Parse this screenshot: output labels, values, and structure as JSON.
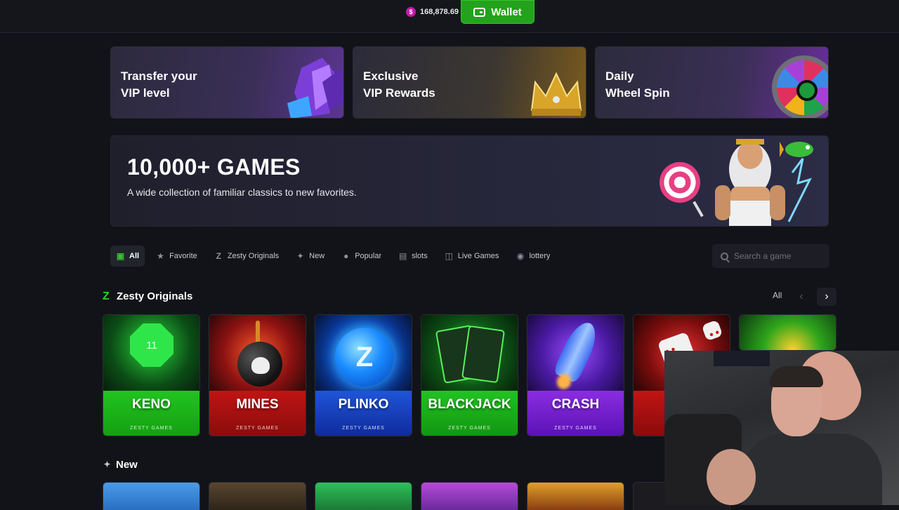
{
  "header": {
    "balance": "168,878.69",
    "balance_symbol": "$",
    "wallet_label": "Wallet"
  },
  "promos": [
    {
      "line1": "Transfer your",
      "line2": "VIP level"
    },
    {
      "line1": "Exclusive",
      "line2": "VIP Rewards"
    },
    {
      "line1": "Daily",
      "line2": "Wheel Spin"
    }
  ],
  "hero": {
    "title": "10,000+ GAMES",
    "subtitle": "A wide collection of familiar classics to new favorites."
  },
  "categories": [
    {
      "label": "All",
      "icon": "slot-machine-icon",
      "active": true
    },
    {
      "label": "Favorite",
      "icon": "star-icon"
    },
    {
      "label": "Zesty Originals",
      "icon": "z-logo-icon"
    },
    {
      "label": "New",
      "icon": "sparkle-star-icon"
    },
    {
      "label": "Popular",
      "icon": "flame-icon"
    },
    {
      "label": "slots",
      "icon": "slot-icon"
    },
    {
      "label": "Live Games",
      "icon": "live-games-icon"
    },
    {
      "label": "lottery",
      "icon": "lottery-ball-icon"
    }
  ],
  "search": {
    "placeholder": "Search a game"
  },
  "originals": {
    "title": "Zesty Originals",
    "see_all": "All",
    "games": [
      {
        "name": "KENO",
        "studio": "ZESTY GAMES",
        "badge": "11"
      },
      {
        "name": "MINES",
        "studio": "ZESTY GAMES"
      },
      {
        "name": "PLINKO",
        "studio": "ZESTY GAMES"
      },
      {
        "name": "BLACKJACK",
        "studio": "ZESTY GAMES"
      },
      {
        "name": "CRASH",
        "studio": "ZESTY GAMES"
      }
    ]
  },
  "new_section": {
    "title": "New"
  },
  "colors": {
    "accent_green": "#23a31c",
    "background": "#121318"
  }
}
